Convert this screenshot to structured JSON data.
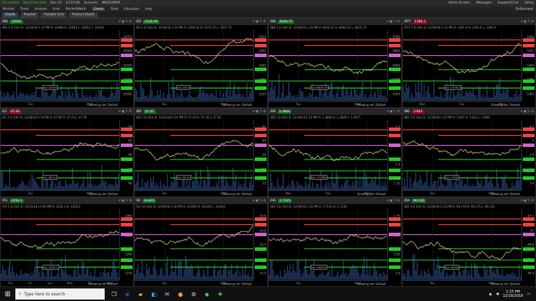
{
  "topbar": {
    "status": "Connected",
    "mode": "Real-time data",
    "date": "Dec 19",
    "time": "13:15:09",
    "account_label": "Account:",
    "account": "865214659",
    "home": "Home Screen",
    "messages": "Messages",
    "support": "Support/Chat",
    "setup": "Setup"
  },
  "menubar": {
    "items": [
      "Monitor",
      "Trade",
      "Analyze",
      "Scan",
      "MarketWatch",
      "Charts",
      "Tools",
      "Education",
      "Help"
    ],
    "ondemand": "OnDemand"
  },
  "toolbar": {
    "tabs": [
      "Charts",
      "Prophet",
      "Flexible Grid",
      "Product Depth"
    ]
  },
  "colors": {
    "up": "#0a7a20",
    "down": "#b3001b",
    "price": "#d9cc8a",
    "support": "#22cc22",
    "resistance": "#ee4444",
    "pivot": "#cc66cc"
  },
  "drawing_set": "Drawing set: Default",
  "panels": [
    {
      "sym": "/NQ",
      "price": "23591",
      "dir": "up",
      "sub": "/NQ 5 D 10m",
      "info": "D: 12/18/18 1:10 PM  O: 22968  H: 22814  L: 22810  C: 22914",
      "days": [
        "Tue",
        "Wed"
      ],
      "lo": "Lo: 21874",
      "ticks": [
        "24750",
        "24500",
        "24250",
        "23750",
        "23500"
      ]
    },
    {
      "sym": "/ES",
      "price": "2540.00",
      "dir": "up",
      "sub": "/ES 5 D 10m",
      "info": "D: 12/18/18 1:10 PM  O: 2569.25  H: 2571.25  L: 2567.75",
      "days": [
        "Tue",
        "Wed"
      ],
      "lo": "Lo: 2524",
      "ticks": [
        "2620",
        "2600",
        "2580",
        "2540",
        "2520"
      ]
    },
    {
      "sym": "/NQ",
      "price": "6048.75",
      "dir": "up",
      "sub": "/NQ 5 D 10m",
      "info": "D: 12/18/18 1:10 PM  O: 6030.25  H: 6040.25  L: 6025.75",
      "days": [
        "Tue",
        "Wed"
      ],
      "lo": "Lo: 6403.25",
      "ticks": [
        "6700",
        "6600",
        "6400",
        "6300",
        "6200"
      ]
    },
    {
      "sym": "/RTY",
      "price": "1398.1",
      "dir": "dn",
      "sub": "/RTY 5 D 10m",
      "info": "D: 12/18/18 1:10 PM  O: 1391.4  H: 1391.6  L: 1391.4",
      "days": [
        "Mon",
        "Tue",
        "Wed"
      ],
      "lo": "Lo: 1379.4",
      "ticks": [
        "1440",
        "1420",
        "1400",
        "1380",
        "1360"
      ]
    },
    {
      "sym": "/CL",
      "price": "47.64",
      "dir": "dn",
      "sub": "/CL 5 D 10m",
      "info": "D: 12/18/18 1:10 PM  O: 47.09  H: 47.74  L: 47.59",
      "days": [
        "Tue",
        "Wed"
      ],
      "lo": "Lo: 46.11",
      "ticks": [
        "50",
        "49",
        "48",
        "47",
        "46"
      ]
    },
    {
      "sym": "/BZ",
      "price": "57.07",
      "dir": "up",
      "sub": "/BZ 5 D 10m",
      "info": "D: 12/18/18 1:10 PM  O: 57.20  H: 57.30  L: 57.02",
      "days": [
        "Tue",
        "Wed"
      ],
      "lo": "Lo: 55.47",
      "ticks": [
        "62",
        "60",
        "58",
        "56",
        "55"
      ]
    },
    {
      "sym": "/RB",
      "price": "1.3844",
      "dir": "up",
      "sub": "/RB 5 D 10m",
      "info": "D: 12/18/18 1:10 PM  O: 1.3800  H: 1.3828  L: 1.3677",
      "days": [
        "Mon",
        "Tue",
        "Wed"
      ],
      "lo": "Lo: 1.3398",
      "ticks": [
        "1.5",
        "1.45",
        "1.4",
        "1.35"
      ]
    },
    {
      "sym": "/NG",
      "price": "3.603",
      "dir": "dn",
      "sub": "/NG 5 D 10m",
      "info": "D: 12/18/18 1:10 PM  O: 3.607  H: 3.612  L: 3.606",
      "days": [
        "Tue",
        "Wed"
      ],
      "lo": "Lo: 3.516",
      "ticks": [
        "4.2",
        "4",
        "3.8",
        "3.6",
        "3.4"
      ]
    },
    {
      "sym": "/YG",
      "price": "1256.1",
      "dir": "up",
      "sub": "/YG 5 D 10m",
      "info": "D: 12/19/18 12:09 PM  O: 1256.3  H: 1256.4",
      "days": [
        "Thu",
        "Fri",
        "Sun",
        "Mon",
        "Tue",
        "Wed"
      ],
      "lo": "Lo: 1233.1",
      "ticks": [
        "1260",
        "1250",
        "1240",
        "1230"
      ]
    },
    {
      "sym": "/SI",
      "price": "14.835",
      "dir": "up",
      "sub": "/SI 5 D 10m",
      "info": "D: 12/18/18 1:10 PM  O: 14.825  H: 14.835  L: 14.825",
      "days": [
        "Tue",
        "Wed"
      ],
      "lo": "",
      "ticks": [
        "14.9",
        "14.8",
        "14.7",
        "14.6",
        "14.5"
      ]
    },
    {
      "sym": "/HG",
      "price": "2.7125",
      "dir": "up",
      "sub": "/HG 5 D 10m",
      "info": "D: 12/18/18 1:10 PM  O: 2.7125  H: 2.7130",
      "days": [
        "Tue",
        "Wed"
      ],
      "lo": "Lo: 2.6515",
      "ticks": [
        "2.75",
        "2.7",
        "2.65",
        "2.6"
      ]
    },
    {
      "sym": "/DX",
      "price": "96.100",
      "dir": "up",
      "sub": "/DX 5 D 10m",
      "info": "D: 12/18/18 1:10 PM  O: 96.170  H: 96.175  L: 96.145",
      "days": [
        "Tue",
        "Wed"
      ],
      "lo": "Lo: 96.85",
      "ticks": [
        "97.2",
        "97",
        "96.8",
        "96.6",
        "96.4"
      ]
    }
  ],
  "taskbar": {
    "search_placeholder": "Type here to search",
    "time": "1:15 PM",
    "date": "12/19/2018"
  }
}
